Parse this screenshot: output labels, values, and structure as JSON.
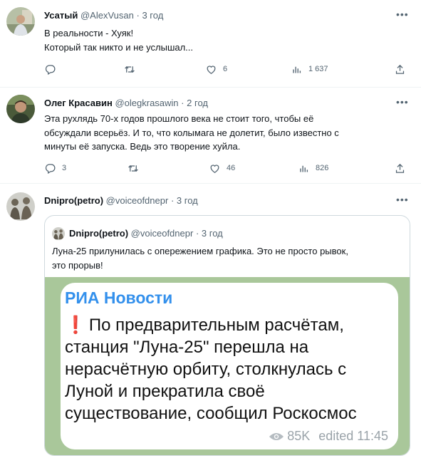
{
  "tweets": [
    {
      "name": "Усатый",
      "handle": "@AlexVusan",
      "time": "3 год",
      "lines": [
        "В реальности - Хуяк!",
        "Который так никто и не услышал..."
      ],
      "replies": "",
      "retweets": "",
      "likes": "6",
      "views": "1 637"
    },
    {
      "name": "Олег Красавин",
      "handle": "@olegkrasawin",
      "time": "2 год",
      "lines": [
        "Эта рухлядь 70-х годов прошлого века не стоит того, чтобы её",
        "обсуждали всерьёз. И то, что колымага не долетит, было известно с",
        "минуты её запуска. Ведь это творение хуйла."
      ],
      "replies": "3",
      "retweets": "",
      "likes": "46",
      "views": "826"
    },
    {
      "name": "Dnipro(petro)",
      "handle": "@voiceofdnepr",
      "time": "3 год"
    }
  ],
  "separator": "·",
  "quote": {
    "name": "Dnipro(petro)",
    "handle": "@voiceofdnepr",
    "time": "3 год",
    "lines": [
      "Луна-25 прилунилась с опережением графика. Это не просто рывок,",
      "это прорыв!"
    ],
    "image": {
      "source": "РИА Новости",
      "excl": "❗",
      "message": "По предварительным расчётам, станция \"Луна-25\" перешла на нерасчётную орбиту, столкнулась с Луной и прекратила своё существование, сообщил Роскосмос",
      "views": "85K",
      "edited": "edited 11:45"
    }
  },
  "icons": [
    "more-icon",
    "reply-icon",
    "retweet-icon",
    "like-icon",
    "views-icon",
    "share-icon",
    "eye-icon"
  ],
  "colors": {
    "text": "#0f1419",
    "secondary": "#536471",
    "border": "#cfd9de",
    "link": "#3390ec",
    "bg": "#ffffff"
  }
}
